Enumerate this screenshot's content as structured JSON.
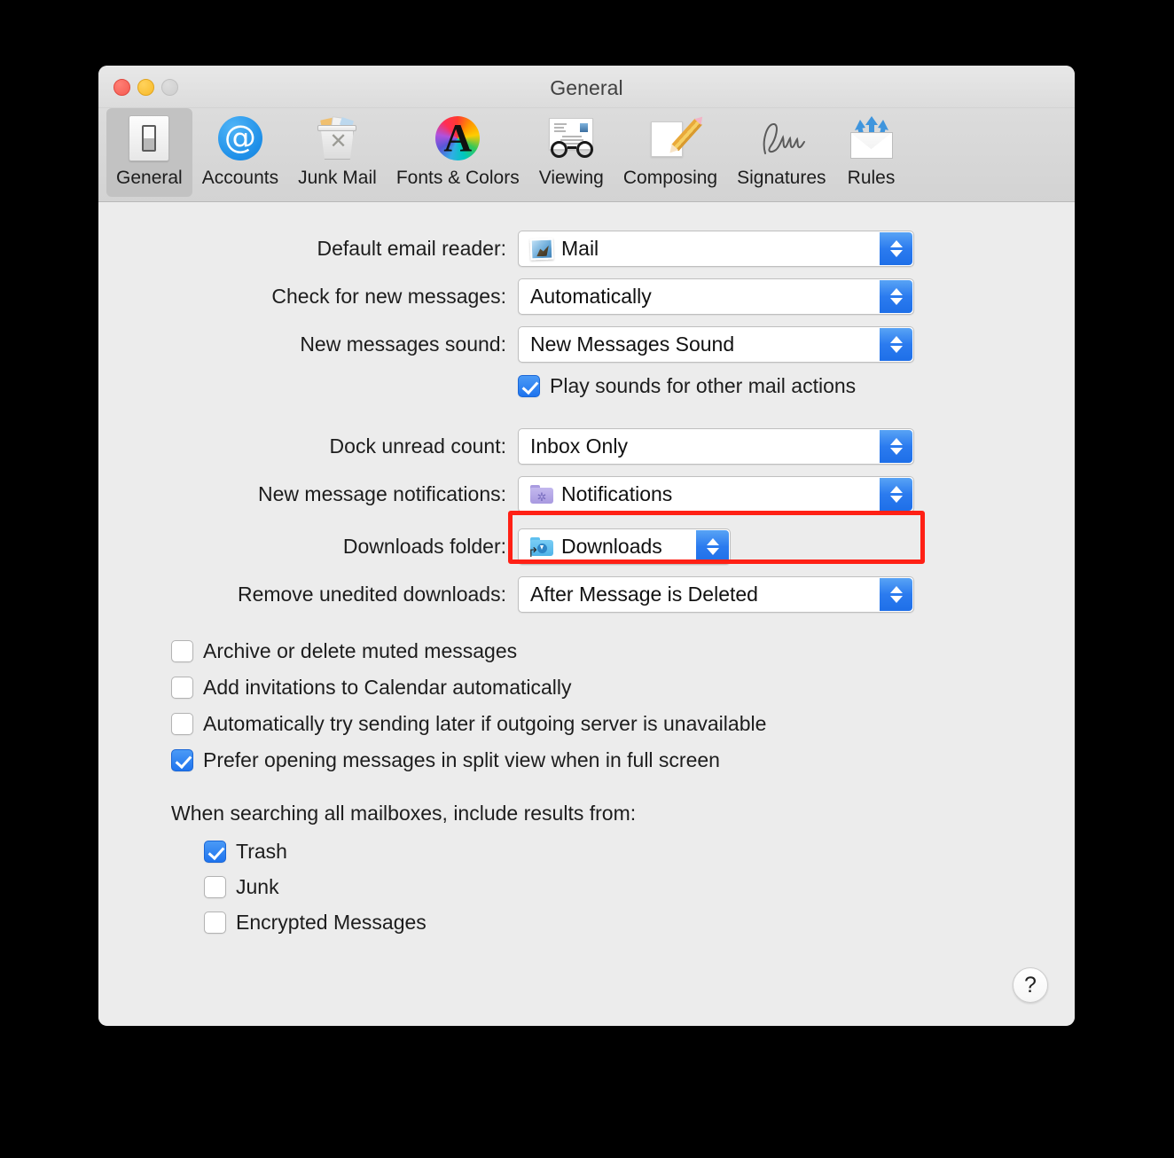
{
  "window": {
    "title": "General",
    "traffic_lights": [
      "close",
      "minimize",
      "zoom"
    ]
  },
  "toolbar": {
    "items": [
      {
        "label": "General",
        "icon": "general-switch-icon",
        "selected": true
      },
      {
        "label": "Accounts",
        "icon": "at-sign-icon",
        "selected": false
      },
      {
        "label": "Junk Mail",
        "icon": "trash-can-icon",
        "selected": false
      },
      {
        "label": "Fonts & Colors",
        "icon": "color-wheel-a-icon",
        "selected": false
      },
      {
        "label": "Viewing",
        "icon": "envelope-glasses-icon",
        "selected": false
      },
      {
        "label": "Composing",
        "icon": "pencil-page-icon",
        "selected": false
      },
      {
        "label": "Signatures",
        "icon": "signature-icon",
        "selected": false
      },
      {
        "label": "Rules",
        "icon": "envelope-arrows-icon",
        "selected": false
      }
    ]
  },
  "settings": {
    "default_email_reader": {
      "label": "Default email reader:",
      "value": "Mail",
      "icon": "mail-app-icon"
    },
    "check_for_new_messages": {
      "label": "Check for new messages:",
      "value": "Automatically",
      "icon": ""
    },
    "new_messages_sound": {
      "label": "New messages sound:",
      "value": "New Messages Sound",
      "icon": ""
    },
    "play_sounds": {
      "label": "Play sounds for other mail actions",
      "checked": true
    },
    "dock_unread_count": {
      "label": "Dock unread count:",
      "value": "Inbox Only",
      "icon": ""
    },
    "new_message_notifications": {
      "label": "New message notifications:",
      "value": "Notifications",
      "icon": "purple-gear-folder-icon",
      "highlighted": true
    },
    "downloads_folder": {
      "label": "Downloads folder:",
      "value": "Downloads",
      "icon": "blue-download-folder-icon"
    },
    "remove_unedited_downloads": {
      "label": "Remove unedited downloads:",
      "value": "After Message is Deleted",
      "icon": ""
    }
  },
  "checkboxes": [
    {
      "label": "Archive or delete muted messages",
      "checked": false
    },
    {
      "label": "Add invitations to Calendar automatically",
      "checked": false
    },
    {
      "label": "Automatically try sending later if outgoing server is unavailable",
      "checked": false
    },
    {
      "label": "Prefer opening messages in split view when in full screen",
      "checked": true
    }
  ],
  "search_section": {
    "title": "When searching all mailboxes, include results from:",
    "options": [
      {
        "label": "Trash",
        "checked": true
      },
      {
        "label": "Junk",
        "checked": false
      },
      {
        "label": "Encrypted Messages",
        "checked": false
      }
    ]
  },
  "help_button": {
    "label": "?"
  },
  "colors": {
    "accent_blue": "#1f74ee",
    "highlight_red": "#ff2015",
    "window_bg": "#ececec",
    "toolbar_bg": "#d6d6d6"
  }
}
